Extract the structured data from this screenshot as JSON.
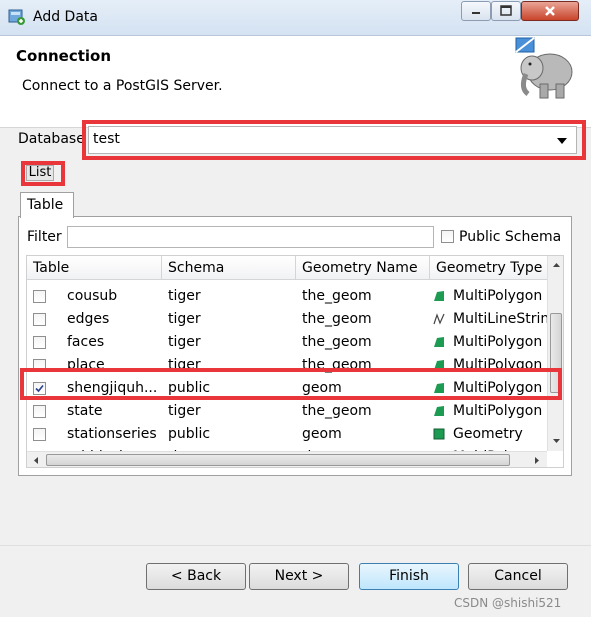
{
  "window": {
    "title": "Add Data",
    "icons": {
      "app": "add-data-icon",
      "minimize": "minimize-icon",
      "maximize": "maximize-icon",
      "close": "close-icon"
    }
  },
  "header": {
    "title": "Connection",
    "description": "Connect to a PostGIS Server.",
    "logo": "postgis-elephant-logo"
  },
  "database": {
    "label": "Database",
    "value": "test"
  },
  "list_button": {
    "label": "List"
  },
  "tabs": [
    {
      "label": "Table"
    }
  ],
  "filter": {
    "label": "Filter",
    "value": ""
  },
  "public_schema": {
    "label": "Public Schema",
    "checked": false
  },
  "table": {
    "columns": [
      "Table",
      "Schema",
      "Geometry Name",
      "Geometry Type"
    ],
    "rows": [
      {
        "table": "cousub",
        "schema": "tiger",
        "geom": "the_geom",
        "type": "MultiPolygon",
        "icon": "multipolygon-icon",
        "checked": false
      },
      {
        "table": "edges",
        "schema": "tiger",
        "geom": "the_geom",
        "type": "MultiLineString",
        "icon": "multilinestring-icon",
        "checked": false
      },
      {
        "table": "faces",
        "schema": "tiger",
        "geom": "the_geom",
        "type": "MultiPolygon",
        "icon": "multipolygon-icon",
        "checked": false
      },
      {
        "table": "place",
        "schema": "tiger",
        "geom": "the_geom",
        "type": "MultiPolygon",
        "icon": "multipolygon-icon",
        "checked": false
      },
      {
        "table": "shengjiquh...",
        "schema": "public",
        "geom": "geom",
        "type": "MultiPolygon",
        "icon": "multipolygon-icon",
        "checked": true
      },
      {
        "table": "state",
        "schema": "tiger",
        "geom": "the_geom",
        "type": "MultiPolygon",
        "icon": "multipolygon-icon",
        "checked": false
      },
      {
        "table": "stationseries",
        "schema": "public",
        "geom": "geom",
        "type": "Geometry",
        "icon": "geometry-icon",
        "checked": false
      },
      {
        "table": "tabblock",
        "schema": "tiger",
        "geom": "the_geom",
        "type": "MultiPolygon",
        "icon": "multipolygon-icon",
        "checked": false
      }
    ]
  },
  "buttons": {
    "back": "< Back",
    "next": "Next >",
    "finish": "Finish",
    "cancel": "Cancel"
  },
  "watermark": "CSDN @shishi521",
  "colors": {
    "highlight": "#e8363b",
    "geom_green": "#1e9b52",
    "finish_border": "#3c7fb1"
  }
}
